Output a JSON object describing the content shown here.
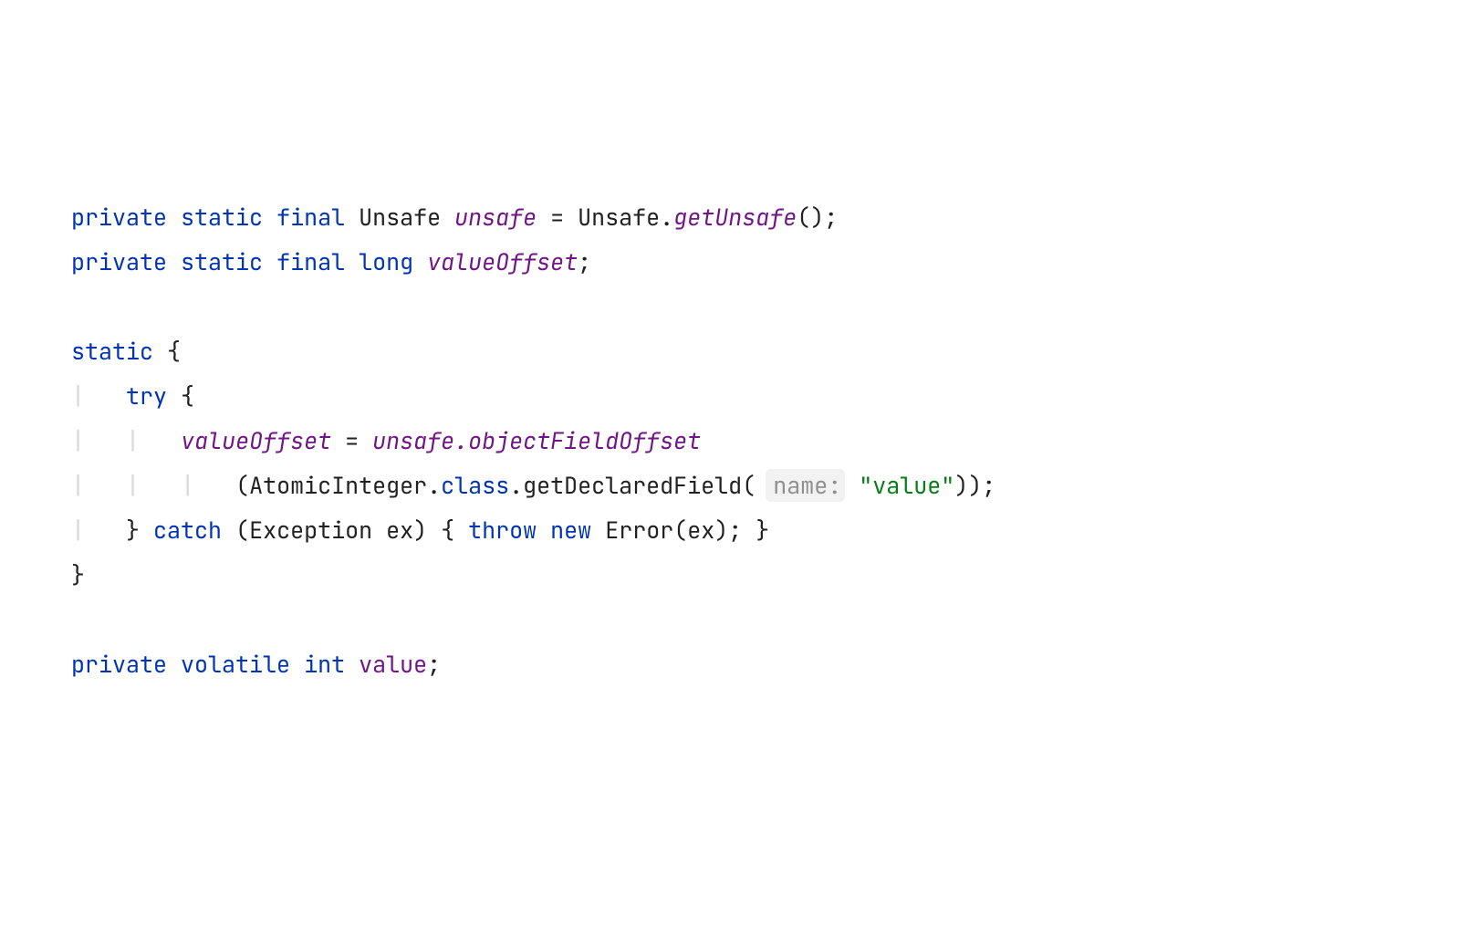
{
  "code": {
    "kw_private": "private",
    "kw_static": "static",
    "kw_final": "final",
    "kw_try": "try",
    "kw_catch": "catch",
    "kw_throw": "throw",
    "kw_new": "new",
    "kw_class": "class",
    "kw_volatile": "volatile",
    "kw_int": "int",
    "kw_long": "long",
    "type_Unsafe": "Unsafe",
    "type_AtomicInteger": "AtomicInteger",
    "type_Exception": "Exception",
    "type_Error": "Error",
    "fld_unsafe": "unsafe",
    "fld_valueOffset": "valueOffset",
    "fld_value": "value",
    "mix_unsafe_objectFieldOffset": "unsafe.objectFieldOffset",
    "m_getUnsafe": "getUnsafe",
    "m_getDeclaredField": "getDeclaredField",
    "var_ex": "ex",
    "param_hint": "name:",
    "str_value": "\"value\"",
    "punct": {
      "assign_get_call": " = Unsafe.",
      "call_end": "();",
      "semi": ";",
      "open_brace": " {",
      "close_brace": "}",
      "assign": " = ",
      "open_paren_atomic": "(AtomicInteger.",
      "dot_getDecl": ".getDeclaredField( ",
      "close_call": "));",
      "catch_open": " (Exception ex) { ",
      "error_call": " Error(ex); }",
      "try_open": " {",
      "sp": " "
    },
    "guide_pipe": "|"
  }
}
